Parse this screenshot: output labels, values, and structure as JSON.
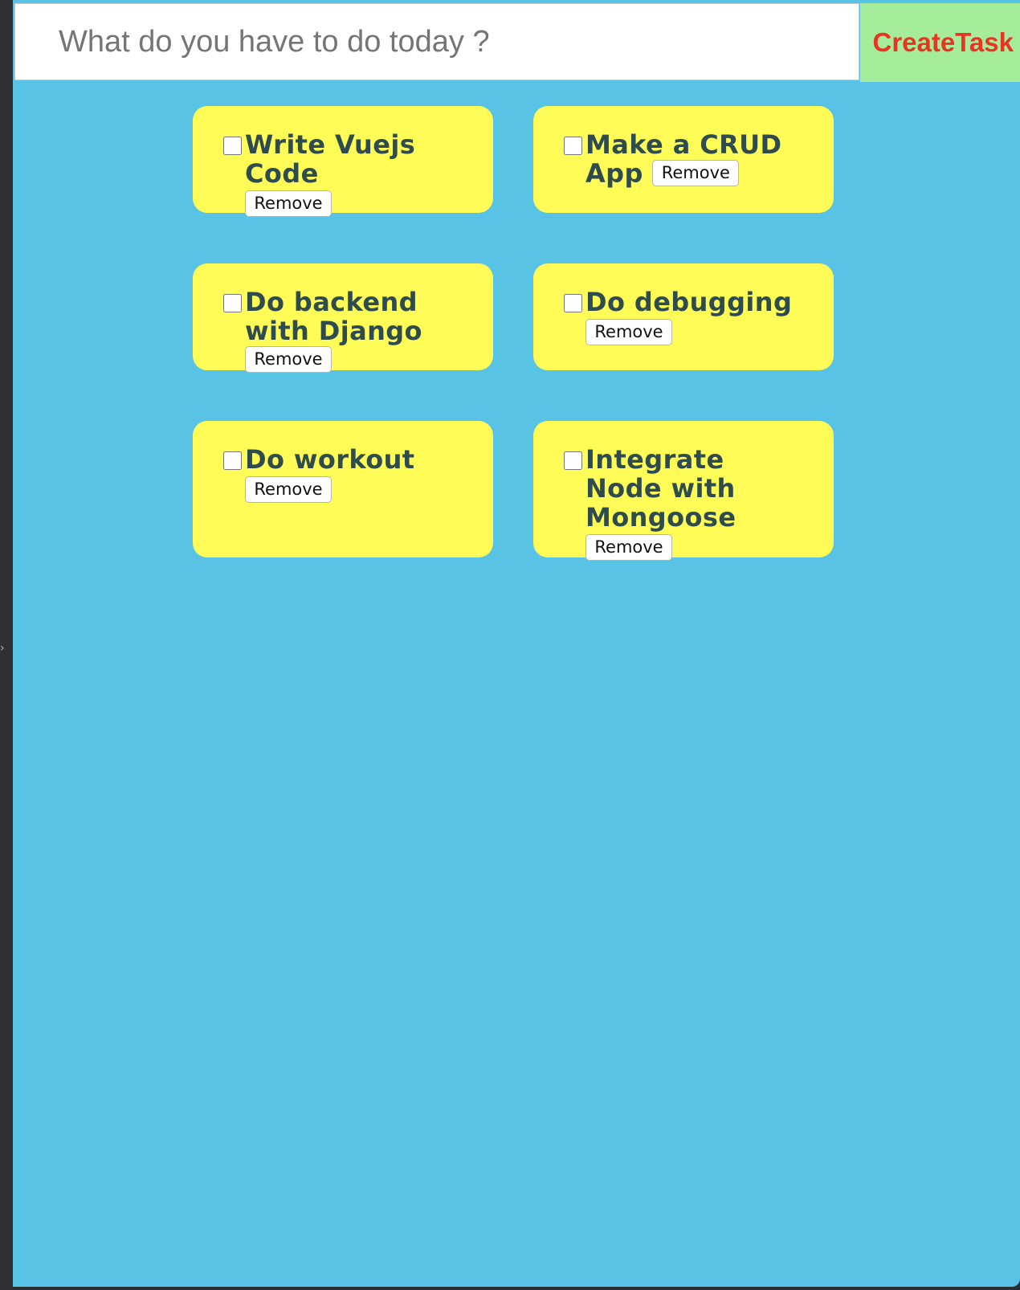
{
  "header": {
    "input_placeholder": "What do you have to do today ?",
    "input_value": "",
    "create_button_label": "CreateTask"
  },
  "tasks": [
    {
      "text": "Write Vuejs Code",
      "done": false,
      "remove_label": "Remove"
    },
    {
      "text": "Make a CRUD App",
      "done": false,
      "remove_label": "Remove"
    },
    {
      "text": "Do backend with Django",
      "done": false,
      "remove_label": "Remove"
    },
    {
      "text": "Do debugging",
      "done": false,
      "remove_label": "Remove"
    },
    {
      "text": "Do workout",
      "done": false,
      "remove_label": "Remove"
    },
    {
      "text": "Integrate Node with Mongoose",
      "done": false,
      "remove_label": "Remove"
    }
  ],
  "colors": {
    "page_background": "#58c3e4",
    "card_background": "#fffc58",
    "task_text": "#2e4c4e",
    "create_button_background": "#a5ed9b",
    "create_button_text": "#e93323"
  },
  "icons": {
    "collapse_arrow": "chevron-right-icon"
  }
}
